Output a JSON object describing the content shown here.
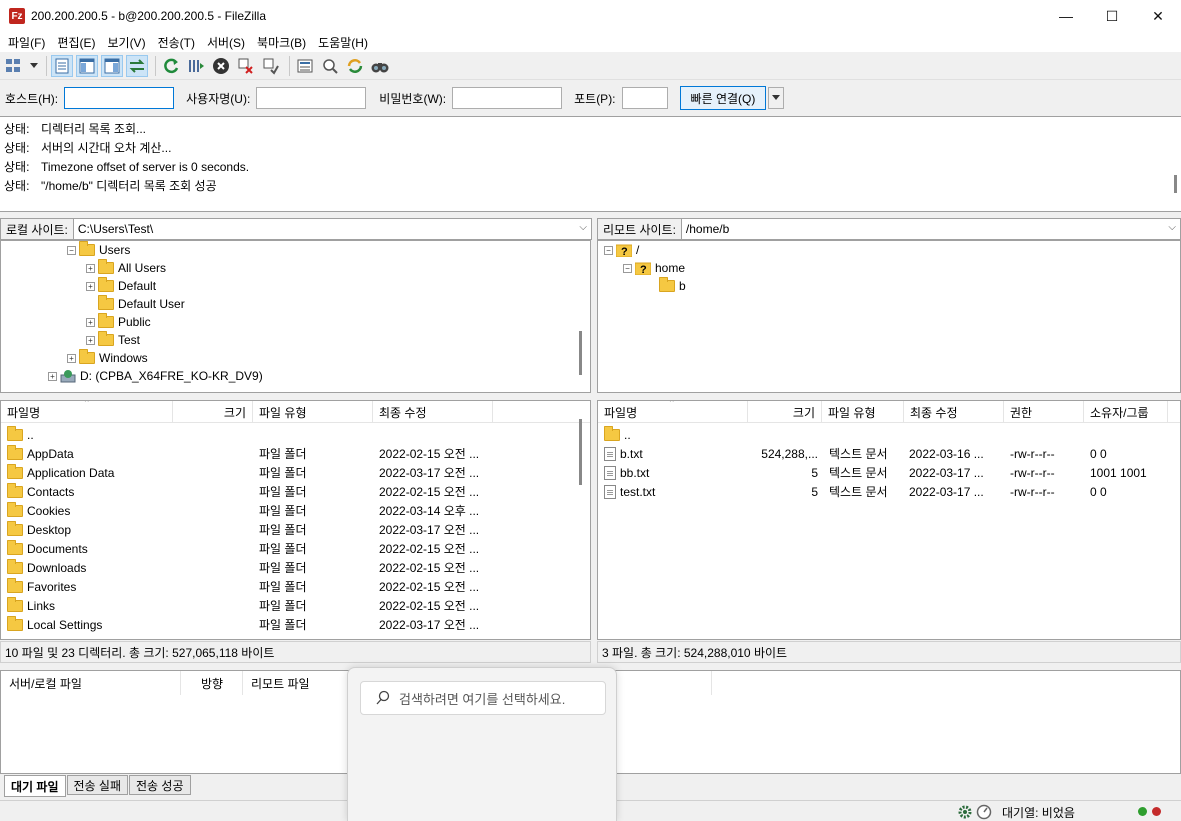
{
  "window": {
    "title": "200.200.200.5 - b@200.200.200.5 - FileZilla",
    "app_icon": "Fz",
    "minimize": "—",
    "maximize": "☐",
    "close": "✕"
  },
  "menu": [
    "파일(F)",
    "편집(E)",
    "보기(V)",
    "전송(T)",
    "서버(S)",
    "북마크(B)",
    "도움말(H)"
  ],
  "quickconnect": {
    "host_label": "호스트(H):",
    "host_value": "",
    "user_label": "사용자명(U):",
    "user_value": "",
    "pass_label": "비밀번호(W):",
    "pass_value": "",
    "port_label": "포트(P):",
    "port_value": "",
    "connect_button": "빠른 연결(Q)"
  },
  "log": [
    {
      "label": "상태:",
      "text": "디렉터리 목록 조회..."
    },
    {
      "label": "상태:",
      "text": "서버의 시간대 오차 계산..."
    },
    {
      "label": "상태:",
      "text": "Timezone offset of server is 0 seconds."
    },
    {
      "label": "상태:",
      "text": "\"/home/b\" 디렉터리 목록 조회 성공"
    }
  ],
  "local": {
    "site_label": "로컬 사이트:",
    "path": "C:\\Users\\Test\\",
    "tree": [
      "Users",
      "All Users",
      "Default",
      "Default User",
      "Public",
      "Test",
      "Windows",
      "D: (CPBA_X64FRE_KO-KR_DV9)"
    ],
    "columns": [
      "파일명",
      "크기",
      "파일 유형",
      "최종 수정"
    ],
    "files": [
      {
        "name": "..",
        "type": "",
        "date": ""
      },
      {
        "name": "AppData",
        "type": "파일 폴더",
        "date": "2022-02-15 오전 ..."
      },
      {
        "name": "Application Data",
        "type": "파일 폴더",
        "date": "2022-03-17 오전 ..."
      },
      {
        "name": "Contacts",
        "type": "파일 폴더",
        "date": "2022-02-15 오전 ..."
      },
      {
        "name": "Cookies",
        "type": "파일 폴더",
        "date": "2022-03-14 오후 ..."
      },
      {
        "name": "Desktop",
        "type": "파일 폴더",
        "date": "2022-03-17 오전 ..."
      },
      {
        "name": "Documents",
        "type": "파일 폴더",
        "date": "2022-02-15 오전 ..."
      },
      {
        "name": "Downloads",
        "type": "파일 폴더",
        "date": "2022-02-15 오전 ..."
      },
      {
        "name": "Favorites",
        "type": "파일 폴더",
        "date": "2022-02-15 오전 ..."
      },
      {
        "name": "Links",
        "type": "파일 폴더",
        "date": "2022-02-15 오전 ..."
      },
      {
        "name": "Local Settings",
        "type": "파일 폴더",
        "date": "2022-03-17 오전 ..."
      }
    ],
    "status": "10 파일 및 23 디렉터리. 총 크기: 527,065,118 바이트"
  },
  "remote": {
    "site_label": "리모트 사이트:",
    "path": "/home/b",
    "tree": [
      "/",
      "home",
      "b"
    ],
    "columns": [
      "파일명",
      "크기",
      "파일 유형",
      "최종 수정",
      "권한",
      "소유자/그룹"
    ],
    "files": [
      {
        "name": "..",
        "size": "",
        "type": "",
        "date": "",
        "perm": "",
        "owner": ""
      },
      {
        "name": "b.txt",
        "size": "524,288,...",
        "type": "텍스트 문서",
        "date": "2022-03-16 ...",
        "perm": "-rw-r--r--",
        "owner": "0 0"
      },
      {
        "name": "bb.txt",
        "size": "5",
        "type": "텍스트 문서",
        "date": "2022-03-17 ...",
        "perm": "-rw-r--r--",
        "owner": "1001 1001"
      },
      {
        "name": "test.txt",
        "size": "5",
        "type": "텍스트 문서",
        "date": "2022-03-17 ...",
        "perm": "-rw-r--r--",
        "owner": "0 0"
      }
    ],
    "status": "3 파일. 총 크기: 524,288,010 바이트"
  },
  "queue": {
    "columns": [
      "서버/로컬 파일",
      "방향",
      "리모트 파일"
    ],
    "tabs": [
      "대기 파일",
      "전송 실패",
      "전송 성공"
    ]
  },
  "statusbar": {
    "queue_text": "대기열: 비었음",
    "led_colors": [
      "#2e9e2e",
      "#c42b2b"
    ]
  },
  "search": {
    "placeholder": "검색하려면 여기를 선택하세요."
  }
}
